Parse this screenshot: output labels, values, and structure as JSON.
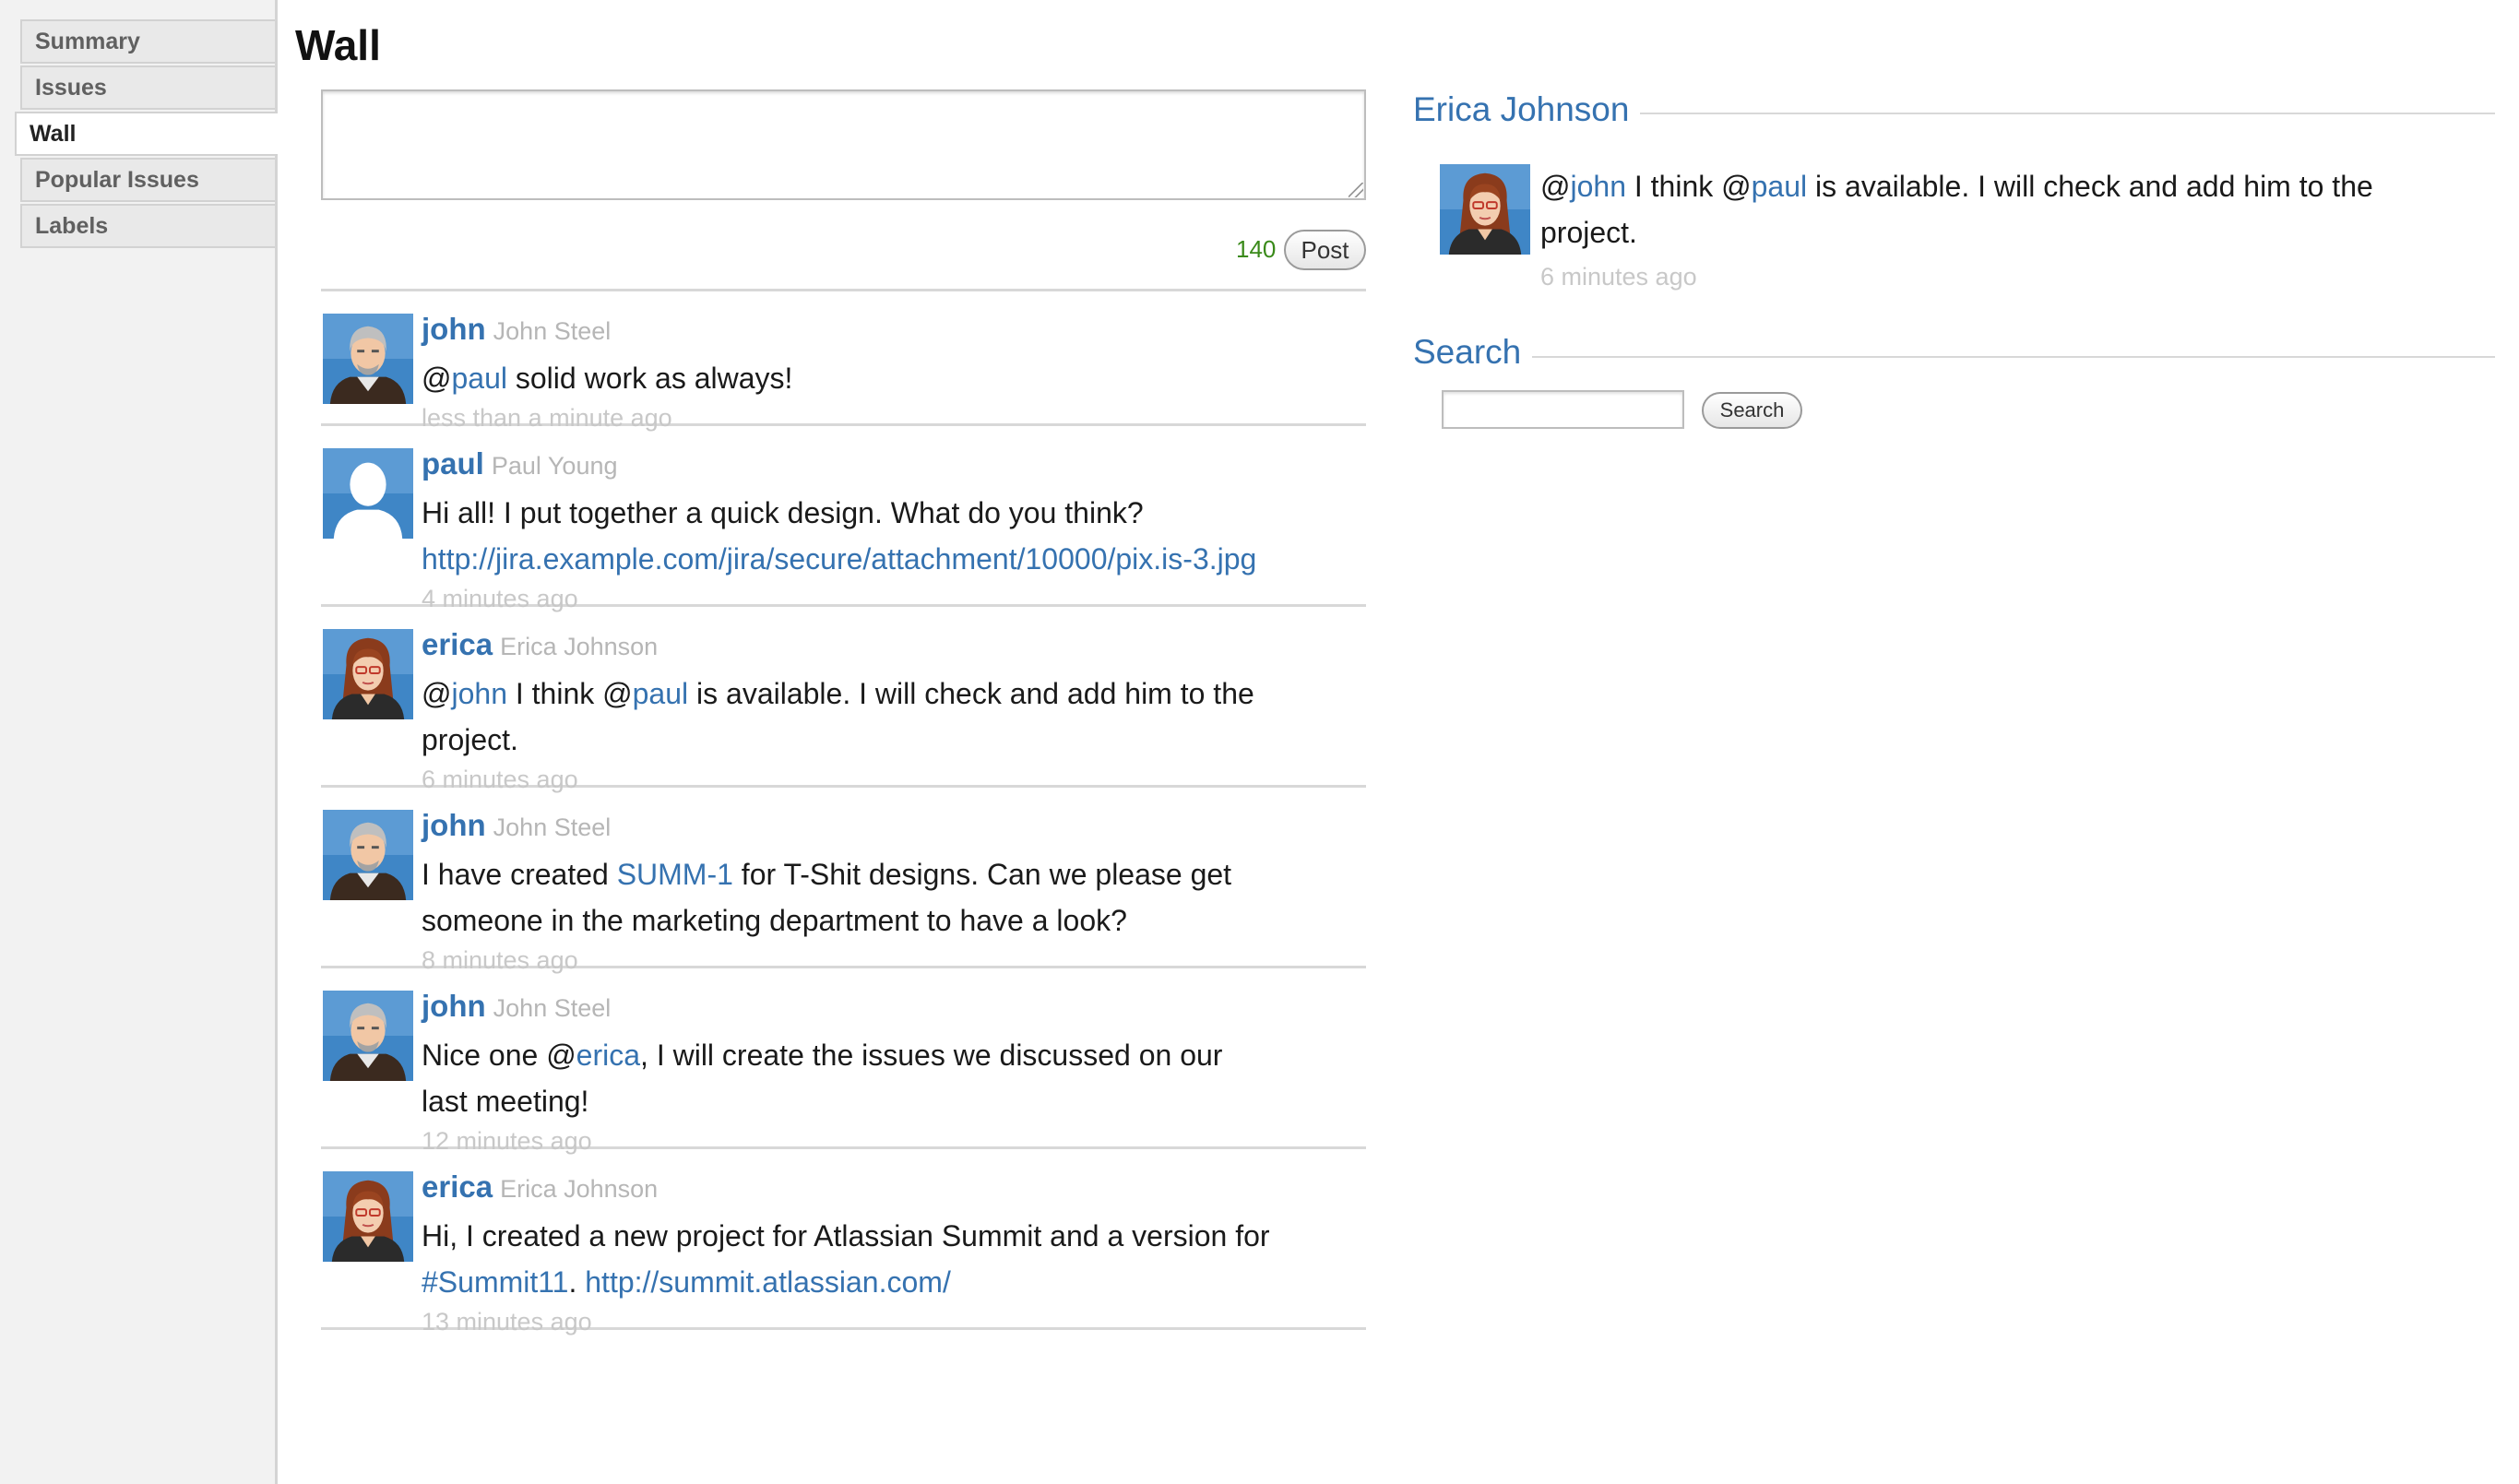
{
  "sidebar": {
    "items": [
      {
        "label": "Summary"
      },
      {
        "label": "Issues"
      },
      {
        "label": "Wall",
        "active": true
      },
      {
        "label": "Popular Issues"
      },
      {
        "label": "Labels"
      }
    ]
  },
  "wall": {
    "title": "Wall",
    "composer": {
      "value": "",
      "remaining_chars": "140",
      "post_label": "Post"
    },
    "posts": [
      {
        "username": "john",
        "fullname": "John Steel",
        "avatar": "male-grey-hair-avatar",
        "text_lines": [
          [
            {
              "t": "@"
            },
            {
              "t": "paul",
              "link": true
            },
            {
              "t": " solid work as always!"
            }
          ]
        ],
        "time": "less than a minute ago"
      },
      {
        "username": "paul",
        "fullname": "Paul Young",
        "avatar": "default-user-avatar",
        "text_lines": [
          [
            {
              "t": "Hi all! I put together a quick design. What do you think?"
            }
          ],
          [
            {
              "t": "http://jira.example.com/jira/secure/attachment/10000/pix.is-3.jpg",
              "link": true
            }
          ]
        ],
        "time": "4 minutes ago"
      },
      {
        "username": "erica",
        "fullname": "Erica Johnson",
        "avatar": "female-red-hair-avatar",
        "text_lines": [
          [
            {
              "t": "@"
            },
            {
              "t": "john",
              "link": true
            },
            {
              "t": " I think @"
            },
            {
              "t": "paul",
              "link": true
            },
            {
              "t": " is available. I will check and add him to the"
            }
          ],
          [
            {
              "t": "project."
            }
          ]
        ],
        "time": "6 minutes ago"
      },
      {
        "username": "john",
        "fullname": "John Steel",
        "avatar": "male-grey-hair-avatar",
        "text_lines": [
          [
            {
              "t": "I have created "
            },
            {
              "t": "SUMM-1",
              "link": true
            },
            {
              "t": " for T-Shit designs. Can we please get"
            }
          ],
          [
            {
              "t": "someone in the marketing department to have a look?"
            }
          ]
        ],
        "time": "8 minutes ago"
      },
      {
        "username": "john",
        "fullname": "John Steel",
        "avatar": "male-grey-hair-avatar",
        "text_lines": [
          [
            {
              "t": "Nice one @"
            },
            {
              "t": "erica",
              "link": true
            },
            {
              "t": ", I will create the issues we discussed on our"
            }
          ],
          [
            {
              "t": "last meeting!"
            }
          ]
        ],
        "time": "12 minutes ago"
      },
      {
        "username": "erica",
        "fullname": "Erica Johnson",
        "avatar": "female-red-hair-avatar",
        "text_lines": [
          [
            {
              "t": "Hi, I created a new project for Atlassian Summit and a version for"
            }
          ],
          [
            {
              "t": "#Summit11",
              "link": true
            },
            {
              "t": ". "
            },
            {
              "t": "http://summit.atlassian.com/",
              "link": true
            }
          ]
        ],
        "time": "13 minutes ago"
      }
    ]
  },
  "profile": {
    "name": "Erica Johnson",
    "avatar": "female-red-hair-avatar",
    "latest_post": {
      "text_lines": [
        [
          {
            "t": "@"
          },
          {
            "t": "john",
            "link": true
          },
          {
            "t": " I think @"
          },
          {
            "t": "paul",
            "link": true
          },
          {
            "t": " is available. I will check and add him to the"
          }
        ],
        [
          {
            "t": "project."
          }
        ]
      ],
      "time": "6 minutes ago"
    }
  },
  "search": {
    "title": "Search",
    "value": "",
    "button_label": "Search"
  },
  "colors": {
    "link": "#3572b0",
    "meta": "#c8c8c8",
    "counter": "#3a8a1a"
  }
}
